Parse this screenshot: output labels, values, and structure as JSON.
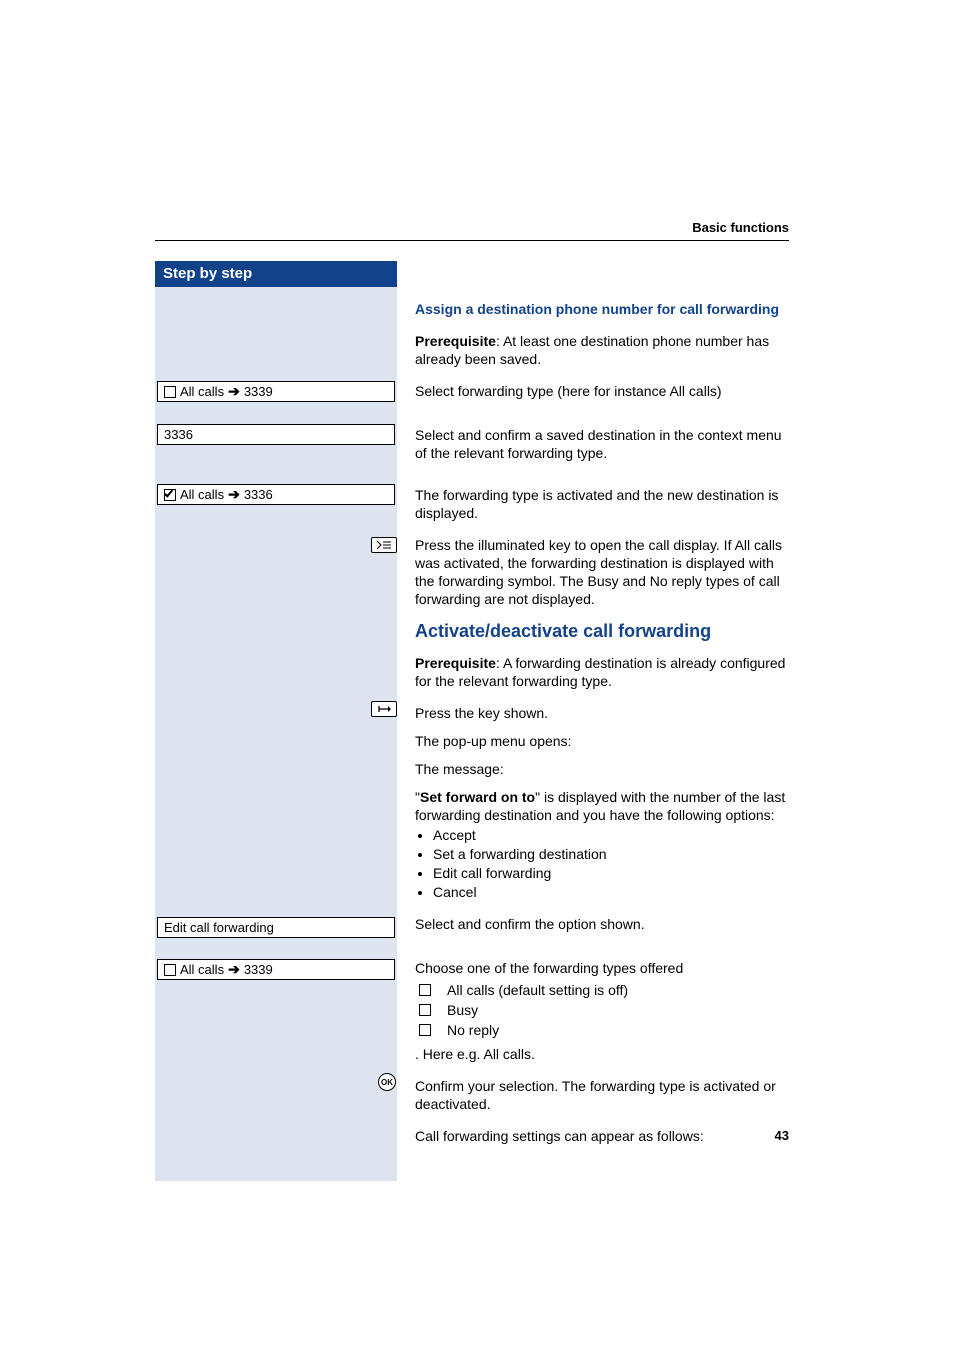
{
  "header": {
    "section": "Basic functions"
  },
  "sidebar": {
    "title": "Step by step",
    "items": {
      "allcalls1": {
        "prefix": "All calls",
        "arrow": "➔",
        "dest": "3339"
      },
      "num": {
        "value": "3336"
      },
      "allcalls2": {
        "prefix": "All calls",
        "arrow": "➔",
        "dest": "3336"
      },
      "editfwd": {
        "label": "Edit call forwarding"
      },
      "allcalls3": {
        "prefix": "All calls",
        "arrow": "➔",
        "dest": "3339"
      }
    }
  },
  "icons": {
    "ok": "OK"
  },
  "content": {
    "assign": {
      "title": "Assign a destination phone number for call forwarding",
      "prereq_label": "Prerequisite",
      "prereq_text": ": At least one destination phone number has already been saved.",
      "p1": "Select forwarding type (here for instance All calls)",
      "p2": "Select and confirm a saved destination in the context menu of the relevant forwarding type.",
      "p3": "The forwarding type is activated and the new destination is displayed.",
      "p4": "Press the illuminated key to open the call display. If All calls was activated, the forwarding destination is displayed with the forwarding symbol. The Busy and No reply types of call forwarding are not displayed."
    },
    "activate": {
      "heading": "Activate/deactivate call forwarding",
      "prereq_label": "Prerequisite",
      "prereq_text": ": A forwarding destination is already configured for the relevant forwarding type.",
      "p1": "Press the key shown.",
      "p2": "The pop-up menu opens:",
      "p3": "The message:",
      "setfwd_bold": "Set forward on to",
      "setfwd_rest": "\" is displayed with the number of the last forwarding destination and you have the following options:",
      "bullets": [
        "Accept",
        "Set a forwarding destination",
        "Edit call forwarding",
        "Cancel"
      ],
      "p4": "Select and confirm the option shown.",
      "p5": "Choose one of the forwarding types offered",
      "checks": [
        "All calls (default setting is off)",
        "Busy",
        "No reply"
      ],
      "p6": ". Here e.g. All calls.",
      "p7": "Confirm your selection. The forwarding type is activated or deactivated.",
      "p8": "Call forwarding settings can appear as follows:"
    }
  },
  "page_number": "43"
}
